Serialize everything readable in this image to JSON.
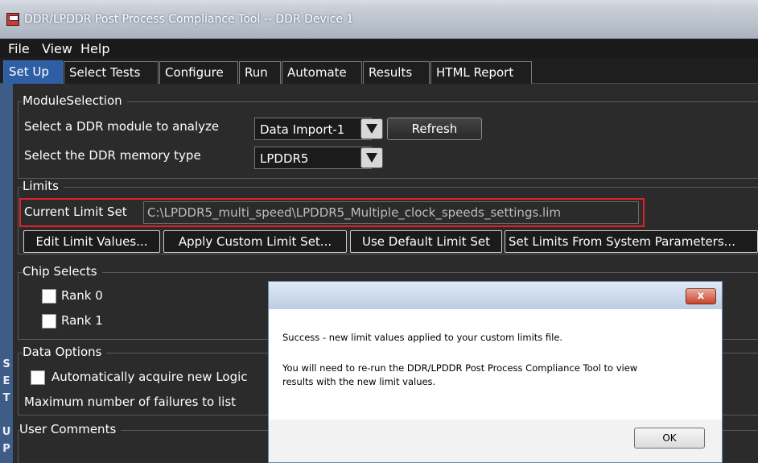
{
  "window": {
    "title": "DDR/LPDDR Post Process Compliance Tool -- DDR Device 1"
  },
  "menu": {
    "items": [
      "File",
      "View",
      "Help"
    ]
  },
  "tabs": [
    {
      "label": "Set Up",
      "active": true
    },
    {
      "label": "Select Tests"
    },
    {
      "label": "Configure"
    },
    {
      "label": "Run"
    },
    {
      "label": "Automate"
    },
    {
      "label": "Results"
    },
    {
      "label": "HTML Report"
    }
  ],
  "side_strip": {
    "letters": [
      "S",
      "E",
      "T",
      "U",
      "P"
    ]
  },
  "module_selection": {
    "title": "ModuleSelection",
    "module_label": "Select a DDR module to analyze",
    "module_value": "Data Import-1",
    "refresh_label": "Refresh",
    "memory_label": "Select the DDR memory type",
    "memory_value": "LPDDR5"
  },
  "limits": {
    "title": "Limits",
    "current_label": "Current Limit Set",
    "current_path": "C:\\LPDDR5_multi_speed\\LPDDR5_Multiple_clock_speeds_settings.lim",
    "buttons": [
      "Edit Limit Values...",
      "Apply Custom Limit Set...",
      "Use Default Limit Set",
      "Set Limits From System Parameters..."
    ]
  },
  "chip_selects": {
    "title": "Chip Selects",
    "ranks": [
      {
        "label": "Rank 0",
        "checked": false
      },
      {
        "label": "Rank 1",
        "checked": false
      }
    ]
  },
  "data_options": {
    "title": "Data Options",
    "auto_acquire_label": "Automatically acquire new Logic",
    "max_failures_label": "Maximum number of failures to list"
  },
  "user_comments": {
    "title": "User Comments"
  },
  "dialog": {
    "close_glyph": "x",
    "line1": "Success - new limit values applied to your custom limits file.",
    "line2": "You will need to re-run the DDR/LPDDR Post Process Compliance Tool to view",
    "line3": "results with the new limit values.",
    "ok_label": "OK"
  },
  "colors": {
    "background": "#2b2b2b",
    "active_tab": "#2e5fa4",
    "side_strip": "#3d5c88",
    "highlight_border": "#e0212b"
  }
}
